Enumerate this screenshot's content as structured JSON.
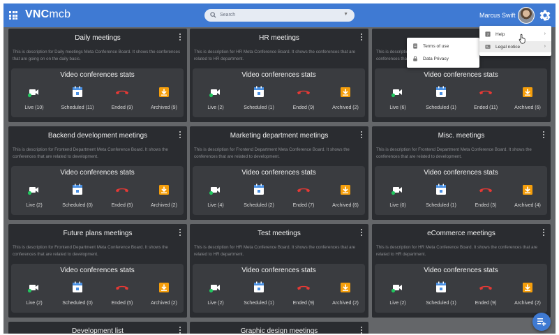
{
  "app": {
    "logo_bold": "VNC",
    "logo_light": "mcb"
  },
  "search": {
    "placeholder": "Search"
  },
  "user": {
    "name": "Marcus Swift"
  },
  "stats_title": "Video conferences stats",
  "cards": [
    {
      "title": "Daily meetings",
      "description": "This is description for Daily meetings Meta Conference Board. It shows the conferences that are going on on the daily basis.",
      "live": "Live (10)",
      "scheduled": "Scheduled (11)",
      "ended": "Ended (9)",
      "archived": "Archived (9)"
    },
    {
      "title": "HR meetings",
      "description": "This is description for HR Meta Conference Board. It shows the conferences that are related to HR department.",
      "live": "Live (2)",
      "scheduled": "Scheduled (1)",
      "ended": "Ended (9)",
      "archived": "Archived (2)"
    },
    {
      "title": "",
      "description": "This is description for Frontend Department Meta Conference Board. It shows the conferences that are related to development.",
      "live": "Live (6)",
      "scheduled": "Scheduled (1)",
      "ended": "Ended (11)",
      "archived": "Archived (6)"
    },
    {
      "title": "Backend development meetings",
      "description": "This is description for Frontend Department  Meta Conference Board. It shows the conferences that are related to development.",
      "live": "Live (2)",
      "scheduled": "Scheduled (0)",
      "ended": "Ended (5)",
      "archived": "Archived (2)"
    },
    {
      "title": "Marketing department meetings",
      "description": "This is description for Frontend Department Meta Conference Board. It shows the conferences that are related to development.",
      "live": "Live (4)",
      "scheduled": "Scheduled (2)",
      "ended": "Ended (7)",
      "archived": "Archived (6)"
    },
    {
      "title": "Misc. meetings",
      "description": "This is description for Frontend Department Meta Conference Board. It shows the conferences that are related to development.",
      "live": "Live (0)",
      "scheduled": "Scheduled (1)",
      "ended": "Ended (3)",
      "archived": "Archived (4)"
    },
    {
      "title": "Future plans meetings",
      "description": "This is description for Frontend Department  Meta Conference Board. It shows the conferences that are related to development.",
      "live": "Live (2)",
      "scheduled": "Scheduled (0)",
      "ended": "Ended (5)",
      "archived": "Archived (2)"
    },
    {
      "title": "Test meetings",
      "description": "This is description for HR Meta Conference Board. It shows the conferences that are related to HR department.",
      "live": "Live (2)",
      "scheduled": "Scheduled (1)",
      "ended": "Ended (9)",
      "archived": "Archived (2)"
    },
    {
      "title": "eCommerce meetings",
      "description": "This is description for HR Meta Conference Board. It shows the conferences that are related to HR department.",
      "live": "Live (2)",
      "scheduled": "Scheduled (1)",
      "ended": "Ended (9)",
      "archived": "Archived (2)"
    }
  ],
  "partial_cards": [
    "Development list",
    "Graphic design meetings"
  ],
  "settings_menu": {
    "help": "Help",
    "legal": "Legal notice"
  },
  "legal_submenu": {
    "terms": "Terms of use",
    "privacy": "Data Privacy"
  },
  "colors": {
    "topbar": "#3f7ad3",
    "card": "#2a2c30",
    "stats_panel": "#3a3c40",
    "live": "#22c55e",
    "scheduled": "#4a90e2",
    "ended": "#e53935",
    "archived": "#f59e0b"
  },
  "icons": {
    "live": "video-camera-icon",
    "scheduled": "calendar-icon",
    "ended": "hangup-phone-icon",
    "archived": "archive-download-icon"
  }
}
